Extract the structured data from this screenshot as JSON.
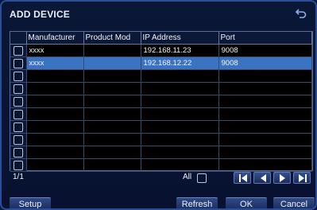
{
  "window": {
    "title": "ADD DEVICE",
    "back_icon": "return-icon"
  },
  "table": {
    "headers": [
      "Manufacturer",
      "Product Mod",
      "IP Address",
      "Port"
    ],
    "rows": [
      {
        "manufacturer": "xxxx",
        "product": "",
        "ip": "192.168.11.23",
        "port": "9008",
        "selected": false
      },
      {
        "manufacturer": "xxxx",
        "product": "",
        "ip": "192.168.12.22",
        "port": "9008",
        "selected": true
      }
    ],
    "selected_color": "#3b73c3"
  },
  "footer": {
    "page": "1/1",
    "all_label": "All",
    "nav_icons": [
      "first-page-icon",
      "prev-page-icon",
      "next-page-icon",
      "last-page-icon"
    ]
  },
  "buttons": {
    "setup": "Setup",
    "refresh": "Refresh",
    "ok": "OK",
    "cancel": "Cancel"
  }
}
